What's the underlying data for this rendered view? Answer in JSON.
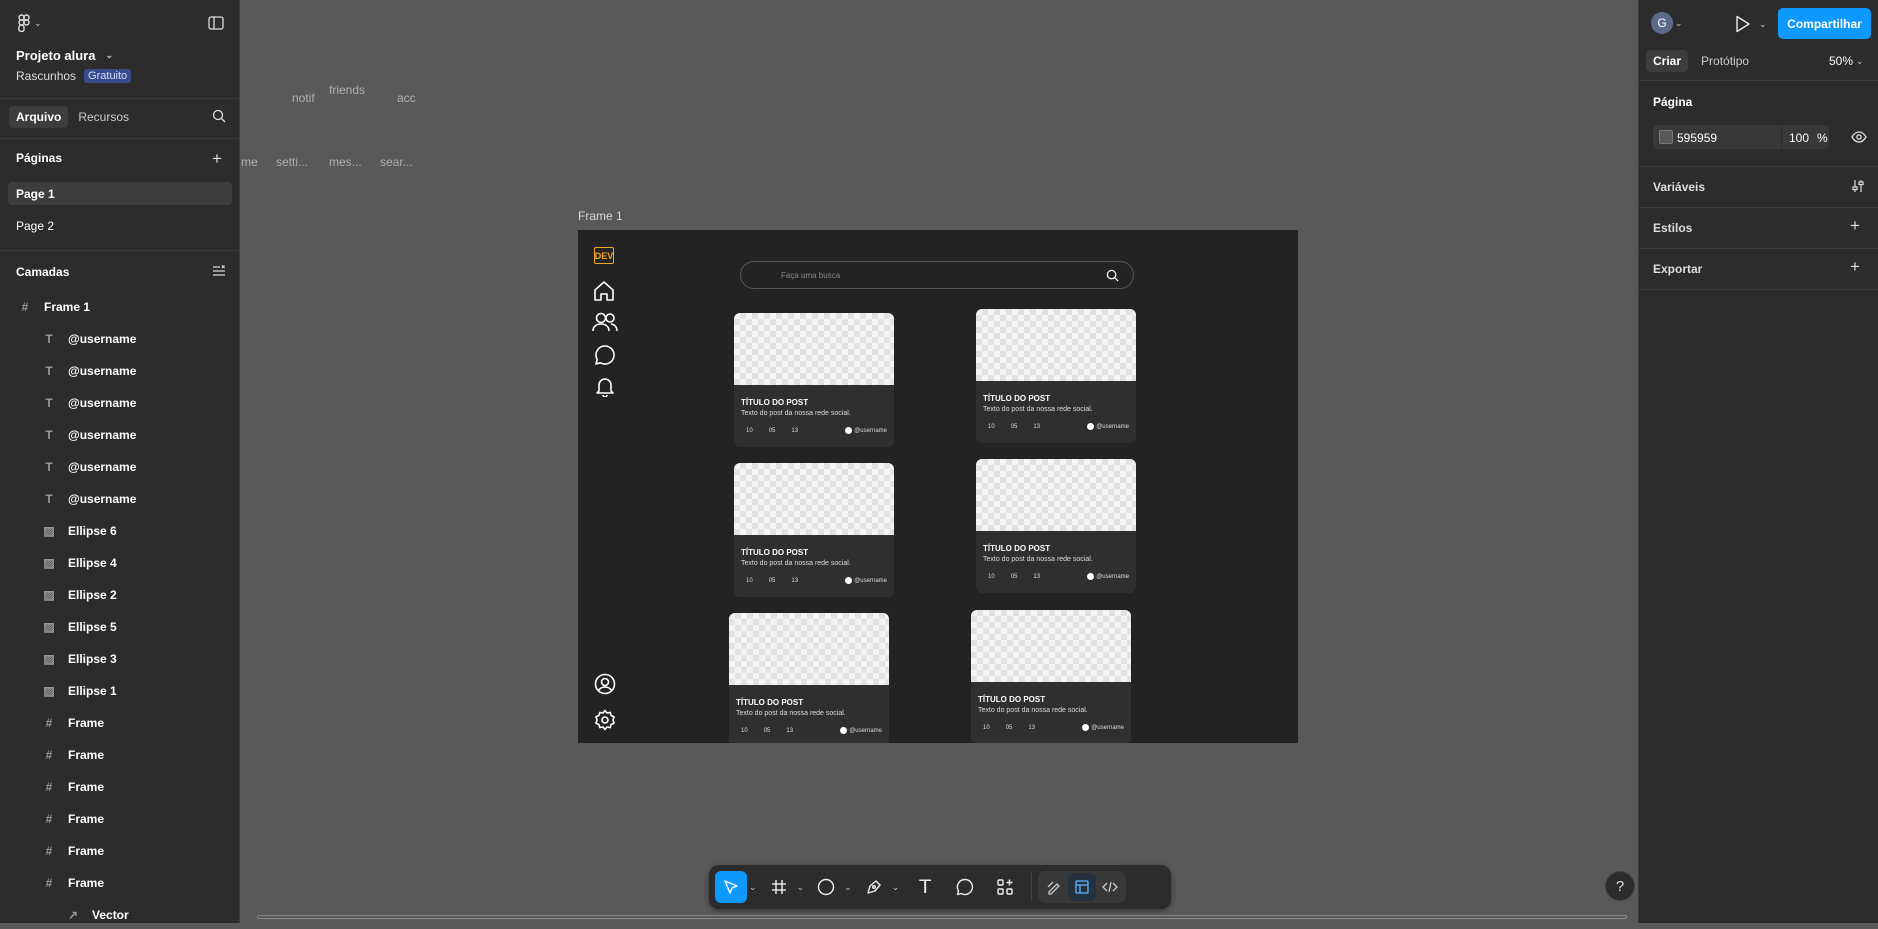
{
  "left": {
    "project_title": "Projeto alura",
    "drafts": "Rascunhos",
    "plan_badge": "Gratuito",
    "tabs": [
      {
        "label": "Arquivo"
      },
      {
        "label": "Recursos"
      }
    ],
    "pages_title": "Páginas",
    "pages": [
      {
        "label": "Page 1"
      },
      {
        "label": "Page 2"
      }
    ],
    "layers_title": "Camadas",
    "layers": [
      {
        "label": "Frame 1"
      },
      {
        "label": "@username"
      },
      {
        "label": "@username"
      },
      {
        "label": "@username"
      },
      {
        "label": "@username"
      },
      {
        "label": "@username"
      },
      {
        "label": "@username"
      },
      {
        "label": "Ellipse 6"
      },
      {
        "label": "Ellipse 4"
      },
      {
        "label": "Ellipse 2"
      },
      {
        "label": "Ellipse 5"
      },
      {
        "label": "Ellipse 3"
      },
      {
        "label": "Ellipse 1"
      },
      {
        "label": "Frame"
      },
      {
        "label": "Frame"
      },
      {
        "label": "Frame"
      },
      {
        "label": "Frame"
      },
      {
        "label": "Frame"
      },
      {
        "label": "Frame"
      },
      {
        "label": "Vector"
      }
    ]
  },
  "canvas": {
    "ghost_labels": [
      "notif",
      "friends",
      "acc",
      "me",
      "setti...",
      "mes...",
      "sear..."
    ],
    "frame_label": "Frame 1",
    "search_placeholder": "Faça uma  busca",
    "logo": "DEV",
    "card": {
      "title": "TÍTULO DO POST",
      "text": "Texto do post da nossa rede social.",
      "stat1": "10",
      "stat2": "05",
      "stat3": "13",
      "username": "@username"
    }
  },
  "right": {
    "avatar_letter": "G",
    "share_button": "Compartilhar",
    "tabs": [
      {
        "label": "Criar"
      },
      {
        "label": "Protótipo"
      }
    ],
    "zoom": "50%",
    "page_section": "Página",
    "page_color_hex": "595959",
    "page_opacity": "100",
    "percent": "%",
    "variables": "Variáveis",
    "styles": "Estilos",
    "export": "Exportar"
  },
  "colors": {
    "canvas_bg": "#595959",
    "panel_bg": "#2c2c2c",
    "accent": "#0d99ff",
    "frame_bg": "#232323",
    "logo": "#f5a623"
  },
  "help": "?"
}
